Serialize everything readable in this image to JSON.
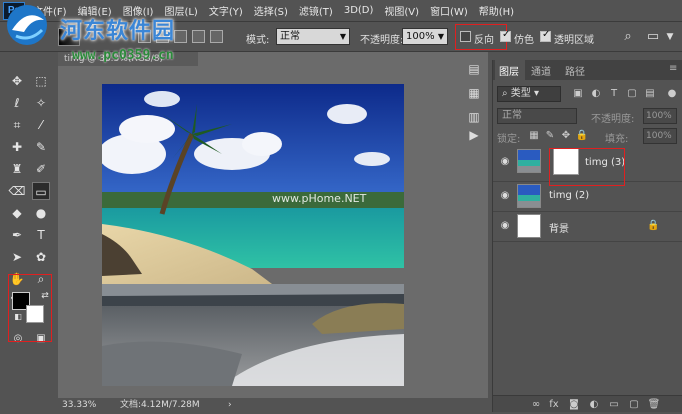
{
  "watermark": {
    "title": "河东软件园",
    "url": "www.pc0359.cn"
  },
  "menubar": {
    "logo": "Ps",
    "items": [
      "文件(F)",
      "编辑(E)",
      "图像(I)",
      "图层(L)",
      "文字(Y)",
      "选择(S)",
      "滤镜(T)",
      "3D(D)",
      "视图(V)",
      "窗口(W)",
      "帮助(H)"
    ]
  },
  "options": {
    "mode_label": "模式:",
    "mode_value": "正常",
    "opacity_label": "不透明度:",
    "opacity_value": "100%",
    "reverse_label": "反向",
    "dither_label": "仿色",
    "transparency_label": "透明区域",
    "reverse_checked": false,
    "dither_checked": true,
    "transparency_checked": true
  },
  "document": {
    "tab_title": "timg @ 33.3%(RGB/8)",
    "zoom": "33.33%",
    "doc_size": "文档:4.12M/7.28M",
    "canvas_watermark": "www.pHome.NET"
  },
  "layers_panel": {
    "tabs": [
      "图层",
      "通道",
      "路径"
    ],
    "filter_kind": "类型",
    "blend_mode": "正常",
    "opacity_label": "不透明度:",
    "opacity_value": "100%",
    "lock_label": "锁定:",
    "fill_label": "填充:",
    "fill_value": "100%",
    "layers": [
      {
        "name": "timg (3)",
        "has_mask": true
      },
      {
        "name": "timg (2)",
        "has_mask": false
      },
      {
        "name": "背景",
        "locked": true
      }
    ]
  },
  "colors": {
    "highlight_red": "#e02020",
    "accent_blue": "#3b86d6",
    "foreground": "#000000",
    "background": "#ffffff"
  }
}
